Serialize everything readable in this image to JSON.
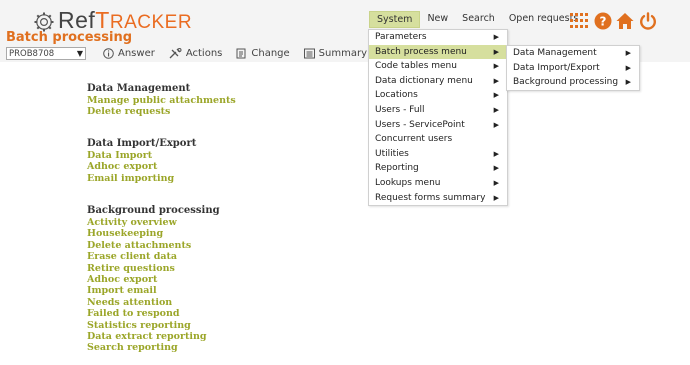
{
  "logo": {
    "ref": "Ref",
    "tracker_initial": "T",
    "tracker_rest": "RACKER"
  },
  "page_title": "Batch processing",
  "toolbar": {
    "request_select": {
      "value": "PROB8708"
    },
    "answer_label": "Answer",
    "actions_label": "Actions",
    "change_label": "Change",
    "summary_label": "Summary"
  },
  "nav": {
    "system": "System",
    "new": "New",
    "search": "Search",
    "open_requests": "Open requests"
  },
  "system_menu": [
    {
      "label": "Parameters",
      "submenu": true
    },
    {
      "label": "Batch process menu",
      "submenu": true,
      "highlighted": true
    },
    {
      "label": "Code tables menu",
      "submenu": true
    },
    {
      "label": "Data dictionary menu",
      "submenu": true
    },
    {
      "label": "Locations",
      "submenu": true
    },
    {
      "label": "Users - Full",
      "submenu": true
    },
    {
      "label": "Users - ServicePoint",
      "submenu": true
    },
    {
      "label": "Concurrent users",
      "submenu": false
    },
    {
      "label": "Utilities",
      "submenu": true
    },
    {
      "label": "Reporting",
      "submenu": true
    },
    {
      "label": "Lookups menu",
      "submenu": true
    },
    {
      "label": "Request forms summary",
      "submenu": true
    }
  ],
  "batch_submenu": [
    {
      "label": "Data Management",
      "submenu": true
    },
    {
      "label": "Data Import/Export",
      "submenu": true
    },
    {
      "label": "Background processing",
      "submenu": true
    }
  ],
  "sections": {
    "data_management": {
      "title": "Data Management",
      "links": [
        "Manage public attachments",
        "Delete requests"
      ]
    },
    "data_import_export": {
      "title": "Data Import/Export",
      "links": [
        "Data Import",
        "Adhoc export",
        "Email importing"
      ]
    },
    "background_processing": {
      "title": "Background processing",
      "links": [
        "Activity overview",
        "Housekeeping",
        "Delete attachments",
        "Erase client data",
        "Retire questions",
        "Adhoc export",
        "Import email",
        "Needs attention",
        "Failed to respond",
        "Statistics reporting",
        "Data extract reporting",
        "Search reporting"
      ]
    }
  },
  "colors": {
    "accent_orange": "#e0701f",
    "link_olive": "#9ba629",
    "menu_highlight": "#d6df9e"
  },
  "icons": [
    "gear-icon",
    "info-icon",
    "actions-icon",
    "change-icon",
    "summary-icon",
    "apps-grid-icon",
    "help-icon",
    "home-icon",
    "power-icon",
    "chevron-right-icon",
    "dropdown-arrow-icon"
  ]
}
